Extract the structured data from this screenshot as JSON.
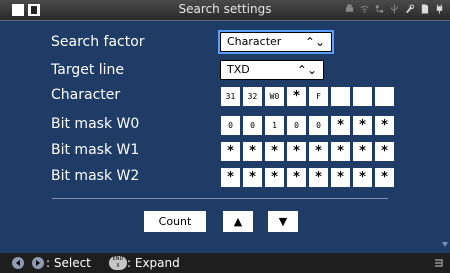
{
  "window": {
    "title": "Search settings"
  },
  "rows": {
    "search_factor": {
      "label": "Search factor",
      "value": "Character"
    },
    "target_line": {
      "label": "Target line",
      "value": "TXD"
    },
    "character": {
      "label": "Character",
      "cells": [
        "31",
        "32",
        "W0",
        "*",
        "F",
        "",
        "",
        ""
      ]
    },
    "bit_mask_w0": {
      "label": "Bit mask W0",
      "cells": [
        "0",
        "0",
        "1",
        "0",
        "0",
        "*",
        "*",
        "*"
      ]
    },
    "bit_mask_w1": {
      "label": "Bit mask W1",
      "cells": [
        "*",
        "*",
        "*",
        "*",
        "*",
        "*",
        "*",
        "*"
      ]
    },
    "bit_mask_w2": {
      "label": "Bit mask W2",
      "cells": [
        "*",
        "*",
        "*",
        "*",
        "*",
        "*",
        "*",
        "*"
      ]
    }
  },
  "buttons": {
    "count": "Count",
    "up": "▲",
    "down": "▼"
  },
  "footer": {
    "select_hint": ": Select",
    "end_key": "END",
    "end_sub": "X",
    "expand_hint": ": Expand"
  },
  "colors": {
    "panel": "#1f3c66",
    "focus": "#5aa0ff"
  }
}
